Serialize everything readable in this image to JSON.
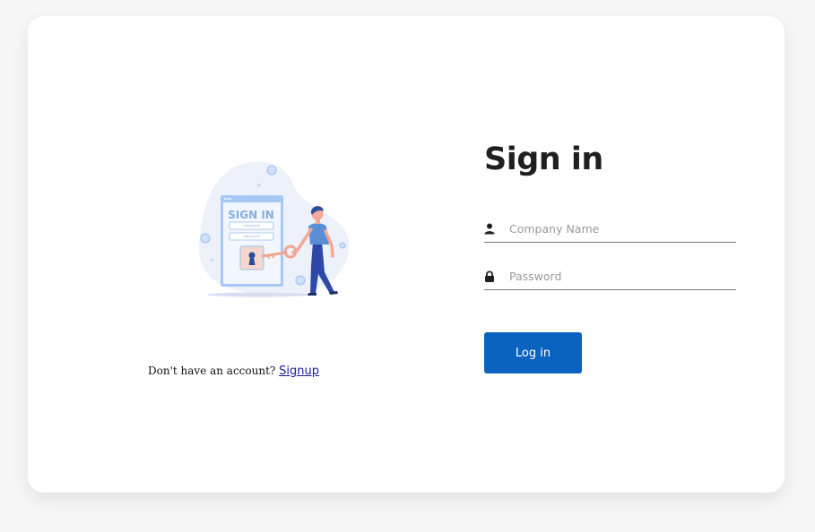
{
  "illustration": {
    "label": "SIGN IN",
    "masked_field_1": "******",
    "masked_field_2": "******"
  },
  "signup": {
    "prompt": "Don't have an account?",
    "link_label": "Signup"
  },
  "form": {
    "title": "Sign in",
    "company_placeholder": "Company Name",
    "company_value": "",
    "password_placeholder": "Password",
    "password_value": "",
    "submit_label": "Log in"
  },
  "colors": {
    "accent": "#0b63c0",
    "background": "#f7f7f7",
    "card": "#ffffff",
    "link": "#1a1aa6"
  },
  "icons": {
    "company": "user-icon",
    "password": "lock-icon"
  }
}
